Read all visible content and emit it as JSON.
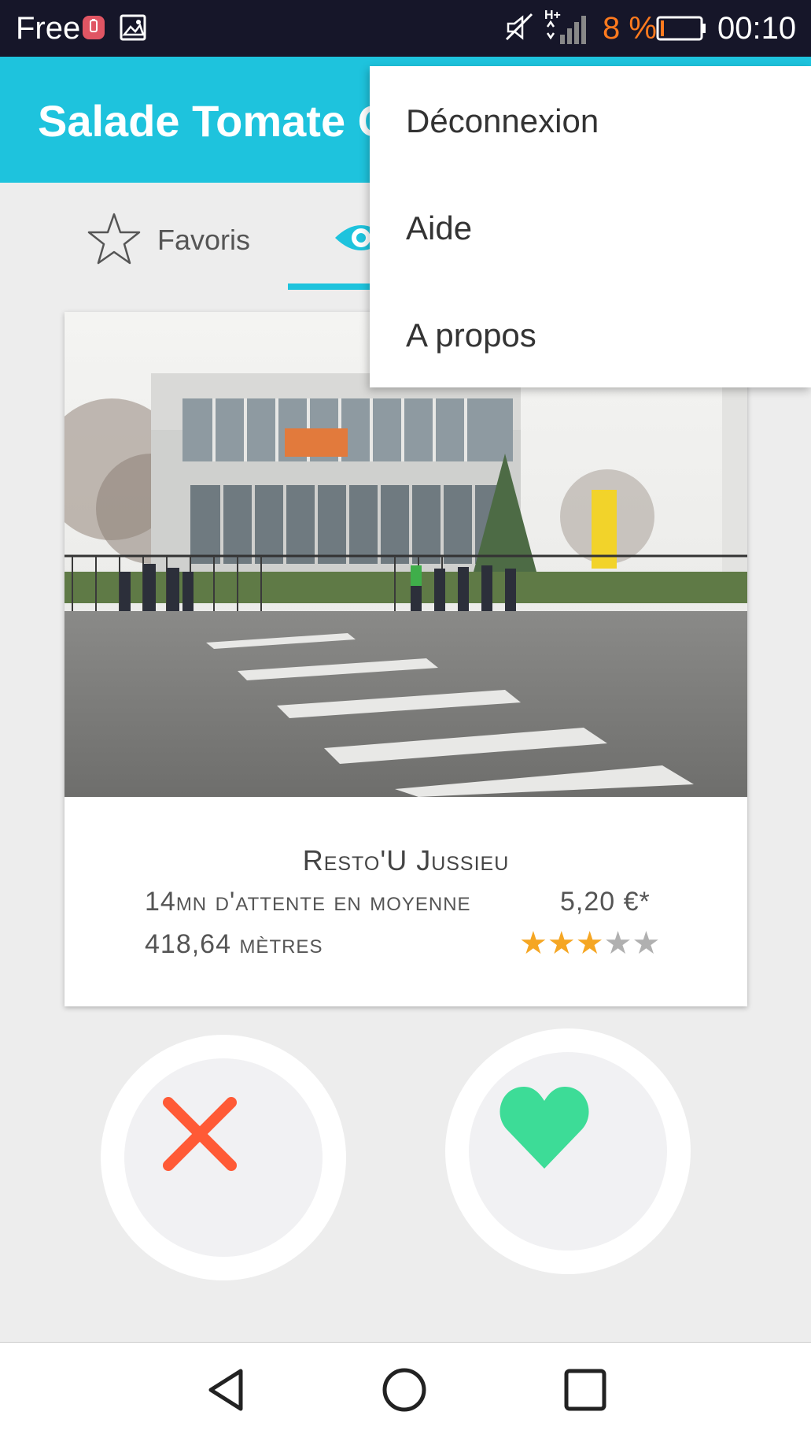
{
  "status_bar": {
    "carrier": "Free",
    "battery_percent": "8 %",
    "time": "00:10",
    "accent_color": "#ff7a1e",
    "icons": [
      "battery-alert-notification-icon",
      "gallery-notification-icon",
      "mute-icon",
      "signal-hplus-icon",
      "battery-icon"
    ]
  },
  "app_bar": {
    "title": "Salade Tomate Oignon",
    "color": "#1ec3dd"
  },
  "tabs": [
    {
      "label": "Favoris",
      "icon": "star-icon"
    },
    {
      "label": "",
      "icon": "eye-icon",
      "selected": true
    }
  ],
  "card": {
    "name": "Resto'U Jussieu",
    "wait": "14mn d'attente en moyenne",
    "price": "5,20 €*",
    "distance": "418,64 mètres",
    "rating": 3,
    "rating_max": 5,
    "photo": "restaurant-building-photo"
  },
  "actions": {
    "dislike_icon": "close-icon",
    "dislike_color": "#ff5a36",
    "like_icon": "heart-icon",
    "like_color": "#3ddc97"
  },
  "menu": {
    "items": [
      "Déconnexion",
      "Aide",
      "A propos"
    ]
  },
  "nav": {
    "icons": [
      "back-icon",
      "home-icon",
      "recents-icon"
    ]
  }
}
